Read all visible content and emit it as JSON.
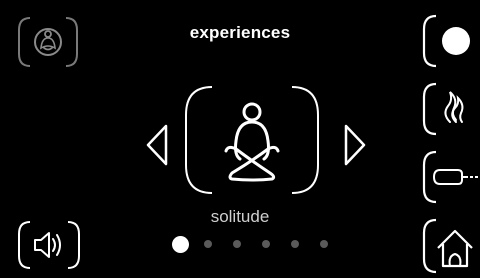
{
  "header": {
    "title": "experiences"
  },
  "carousel": {
    "current_label": "solitude",
    "page_count": 6,
    "active_index": 0
  },
  "icons": {
    "top_left": "meditation-badge-icon",
    "left_arrow": "chevron-left-icon",
    "right_arrow": "chevron-right-icon",
    "center": "meditation-figure-icon",
    "volume": "speaker-icon",
    "light": "circle-light-icon",
    "flame": "flame-icon",
    "plug": "plug-icon",
    "home": "home-icon"
  },
  "colors": {
    "background": "#000000",
    "foreground": "#ffffff",
    "dim": "#8a8a8a",
    "dot_inactive": "#5a5a5a"
  }
}
